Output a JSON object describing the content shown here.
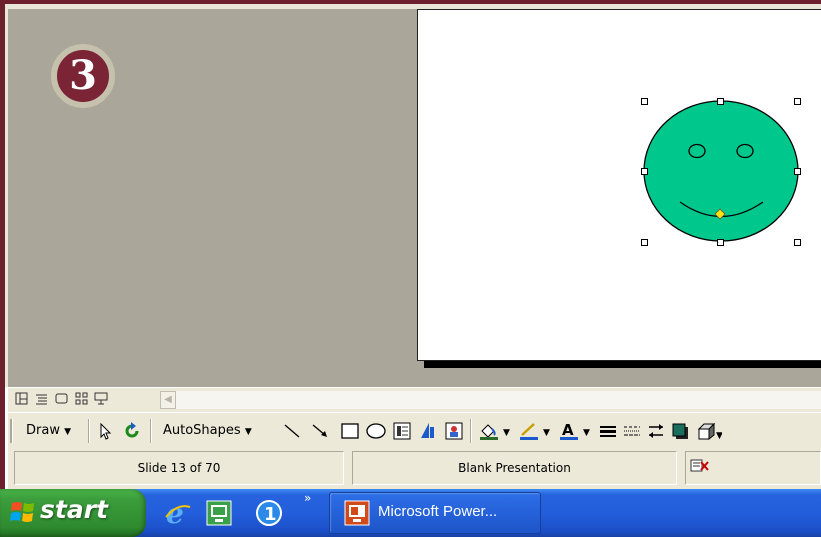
{
  "badge": {
    "number": "3"
  },
  "view_buttons": [
    "normal-view-icon",
    "outline-view-icon",
    "slide-view-icon",
    "slide-sorter-view-icon",
    "slide-show-icon"
  ],
  "drawing_toolbar": {
    "draw_label": "Draw",
    "autoshapes_label": "AutoShapes",
    "tools": [
      "select-pointer-icon",
      "free-rotate-icon",
      "line-icon",
      "arrow-icon",
      "rectangle-icon",
      "oval-icon",
      "text-box-icon",
      "wordart-icon",
      "insert-clip-art-icon",
      "fill-color-icon",
      "line-color-icon",
      "font-color-icon",
      "line-style-icon",
      "dash-style-icon",
      "arrow-style-icon",
      "shadow-icon",
      "3d-icon"
    ]
  },
  "status": {
    "slide_position": "Slide 13 of 70",
    "design_template": "Blank Presentation",
    "spell_check_icon": "spell-check-icon"
  },
  "taskbar": {
    "start_label": "start",
    "quick_launch": [
      "internet-explorer-icon",
      "desktop-icon",
      "application-icon"
    ],
    "chevron": "»",
    "task_label": "Microsoft Power..."
  },
  "colors": {
    "workspace": "#aaa699",
    "smiley_fill": "#00c88c",
    "badge": "#7a2436",
    "taskbar": "#245edb",
    "start_button": "#3c9e3c"
  }
}
